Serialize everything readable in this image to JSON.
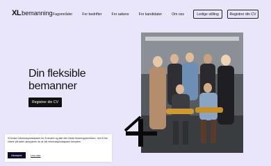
{
  "header": {
    "logo_mark": "XL",
    "logo_word": "bemanning",
    "nav": [
      "Fagområder",
      "For bedrifter",
      "For søkere",
      "For kandidater",
      "Om oss"
    ],
    "btn_ledige": "Ledige stilling",
    "btn_register": "Registrer din CV"
  },
  "hero": {
    "title_line1": "Din fleksible",
    "title_line2": "bemanner",
    "cta": "Registrer din CV"
  },
  "cookie": {
    "text": "Vi bruker informasjonskapsler for å bevare og øke den beste brukeropplevelsen. Ved å bla videre på siden aksepterer du at vår informasjonskapsler benyttes.",
    "accept": "Aksepter",
    "more": "Les mer"
  },
  "colors": {
    "background": "#e9e6fb",
    "dark": "#111111"
  }
}
